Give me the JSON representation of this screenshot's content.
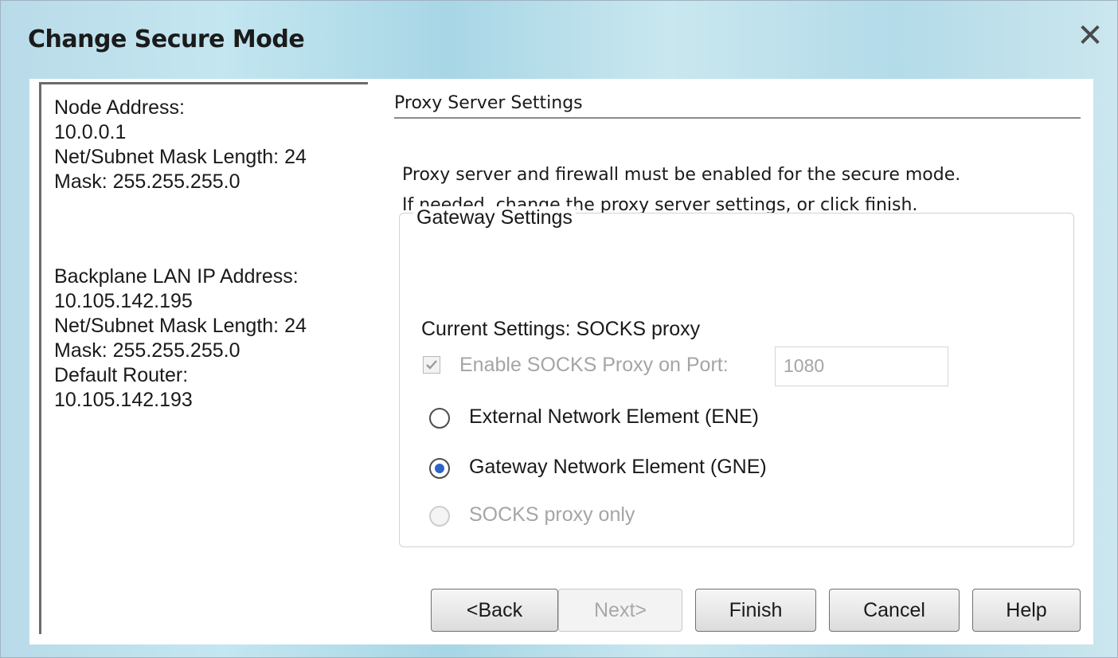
{
  "window": {
    "title": "Change Secure Mode",
    "close_glyph": "✕"
  },
  "info_panel": {
    "node_lines": [
      "Node Address:",
      "10.0.0.1",
      "Net/Subnet Mask Length: 24",
      "Mask: 255.255.255.0"
    ],
    "backplane_lines": [
      "Backplane LAN IP Address:",
      "10.105.142.195",
      "Net/Subnet Mask Length: 24",
      "Mask: 255.255.255.0",
      "Default Router:",
      "10.105.142.193"
    ]
  },
  "section": {
    "header": "Proxy Server Settings",
    "desc_line1": "Proxy server and firewall must be enabled for the secure mode.",
    "desc_line2": "If needed, change the proxy server settings, or click finish."
  },
  "gateway": {
    "group_title": "Gateway Settings",
    "current_settings": "Current Settings: SOCKS proxy",
    "enable_socks_label": "Enable SOCKS Proxy on Port:",
    "enable_socks_checked": true,
    "port_value": "1080",
    "options": [
      {
        "label": "External Network Element (ENE)",
        "selected": false,
        "enabled": true
      },
      {
        "label": "Gateway Network Element (GNE)",
        "selected": true,
        "enabled": true
      },
      {
        "label": "SOCKS proxy only",
        "selected": false,
        "enabled": false
      }
    ]
  },
  "buttons": {
    "back": "<Back",
    "next": "Next>",
    "finish": "Finish",
    "cancel": "Cancel",
    "help": "Help"
  }
}
